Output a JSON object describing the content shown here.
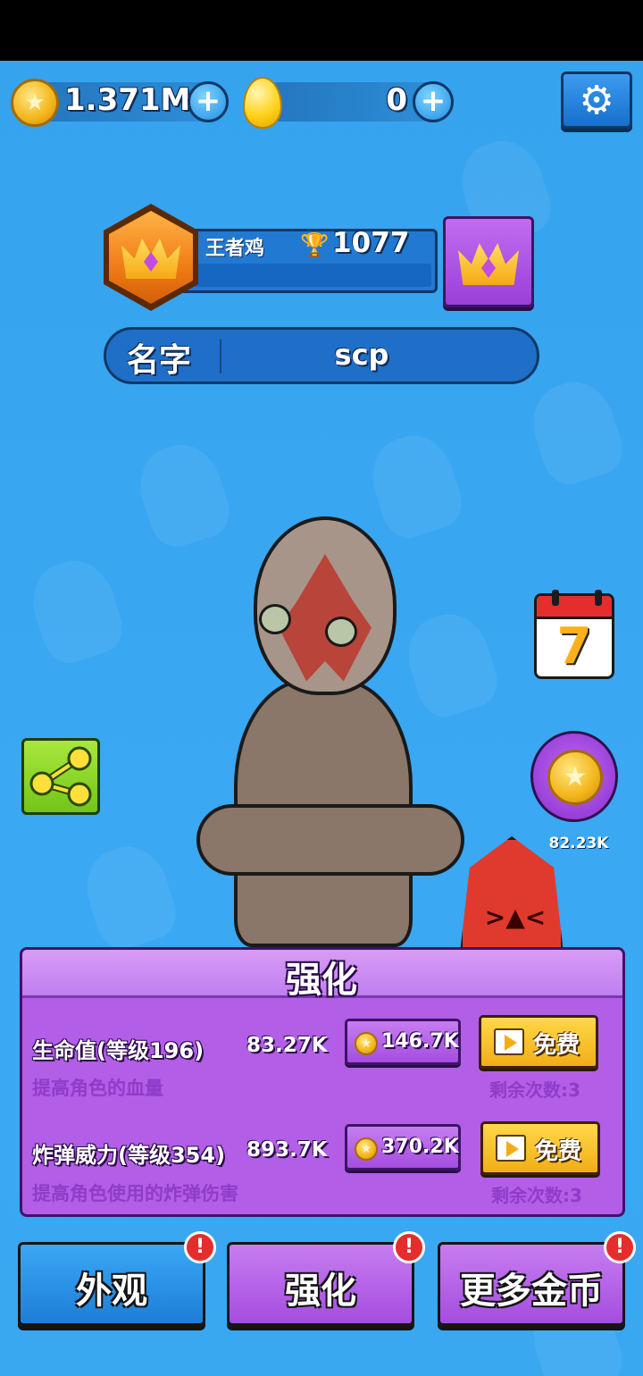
{
  "currency": {
    "coins": "1.371M",
    "gems": "0",
    "coin_symbol": "★",
    "plus_symbol": "+"
  },
  "settings": {
    "icon": "gear-icon",
    "glyph": "⚙"
  },
  "rank": {
    "title": "王者鸡",
    "trophies": "1077",
    "trophy_glyph": "🏆"
  },
  "player": {
    "name_label": "名字",
    "name_value": "scp"
  },
  "side": {
    "calendar_day": "7",
    "reward_amount": "82.23K",
    "coin_glyph": "★"
  },
  "upgrade_panel": {
    "title": "强化",
    "items": [
      {
        "name": "生命值(等级196)",
        "value": "83.27K",
        "description": "提高角色的血量",
        "cost": "146.7K",
        "free_label": "免费",
        "remaining": "剩余次数:3"
      },
      {
        "name": "炸弹威力(等级354)",
        "value": "893.7K",
        "description": "提高角色使用的炸弹伤害",
        "cost": "370.2K",
        "free_label": "免费",
        "remaining": "剩余次数:3"
      }
    ]
  },
  "nav": {
    "appearance": "外观",
    "upgrade": "强化",
    "more_coins": "更多金币",
    "alert_glyph": "!"
  },
  "colors": {
    "background": "#3aa8f3",
    "panel": "#b25ee6",
    "free_button": "#f2ad16"
  }
}
